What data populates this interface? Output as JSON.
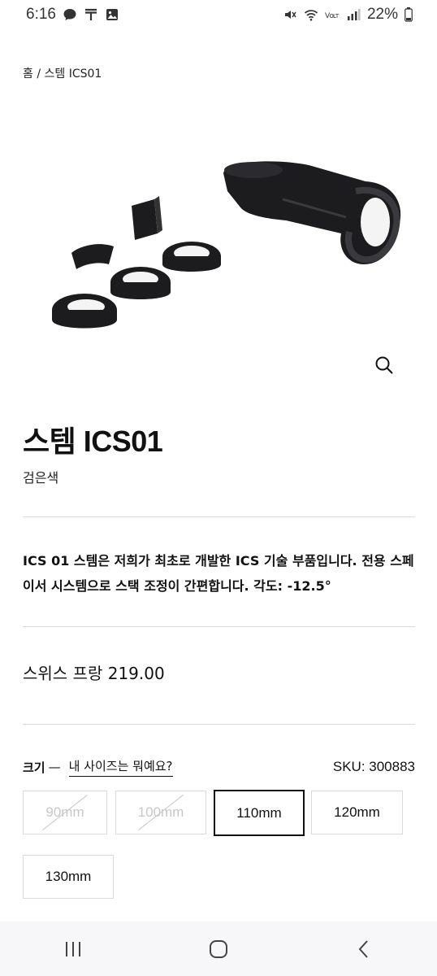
{
  "status_bar": {
    "time": "6:16",
    "battery": "22%",
    "icons_left": [
      "chat-bubble-icon",
      "t-app-icon",
      "gallery-icon"
    ],
    "icons_right": [
      "mute-icon",
      "wifi-icon",
      "volte-icon",
      "signal-icon",
      "battery-icon"
    ]
  },
  "breadcrumb": {
    "text": "홈 / 스템 ICS01"
  },
  "product": {
    "title": "스템 ICS01",
    "color": "검은색",
    "description": "ICS 01 스템은 저희가 최초로 개발한 ICS 기술 부품입니다. 전용 스페이서 시스템으로 스택 조정이 간편합니다. 각도: -12.5°",
    "price": "스위스 프랑 219.00"
  },
  "size": {
    "label": "크기",
    "dash": "—",
    "guide_link": "내 사이즈는 뭐예요?",
    "sku": "SKU: 300883",
    "options": [
      {
        "label": "90mm",
        "state": "unavailable"
      },
      {
        "label": "100mm",
        "state": "unavailable"
      },
      {
        "label": "110mm",
        "state": "selected"
      },
      {
        "label": "120mm",
        "state": "available"
      },
      {
        "label": "130mm",
        "state": "available"
      }
    ]
  },
  "icons": {
    "zoom": "magnifier-icon",
    "nav": [
      "recent-apps-icon",
      "home-icon",
      "back-icon"
    ]
  },
  "colors": {
    "product": "#1c1c1e",
    "selected_border": "#111111",
    "disabled_text": "#c8c8c8"
  }
}
